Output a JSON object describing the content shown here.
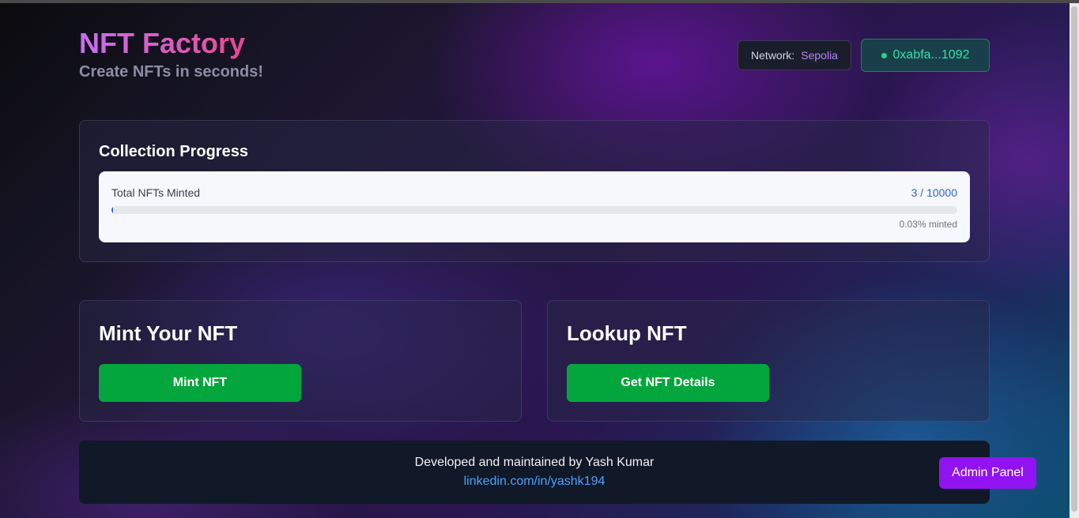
{
  "header": {
    "title": "NFT Factory",
    "subtitle": "Create NFTs in seconds!",
    "network_label": "Network:",
    "network_value": "Sepolia",
    "wallet_address": "0xabfa...1092"
  },
  "progress": {
    "title": "Collection Progress",
    "label": "Total NFTs Minted",
    "count": "3 / 10000",
    "minted": 3,
    "total": 10000,
    "percent_text": "0.03% minted"
  },
  "mint": {
    "title": "Mint Your NFT",
    "button_label": "Mint NFT"
  },
  "lookup": {
    "title": "Lookup NFT",
    "button_label": "Get NFT Details"
  },
  "footer": {
    "credit": "Developed and maintained by Yash Kumar",
    "link_text": "linkedin.com/in/yashk194"
  },
  "admin": {
    "button_label": "Admin Panel"
  },
  "colors": {
    "accent_green": "#02a63d",
    "accent_purple": "#9113f1",
    "progress_blue": "#2f62d6",
    "wallet_green": "#38e0a5"
  }
}
